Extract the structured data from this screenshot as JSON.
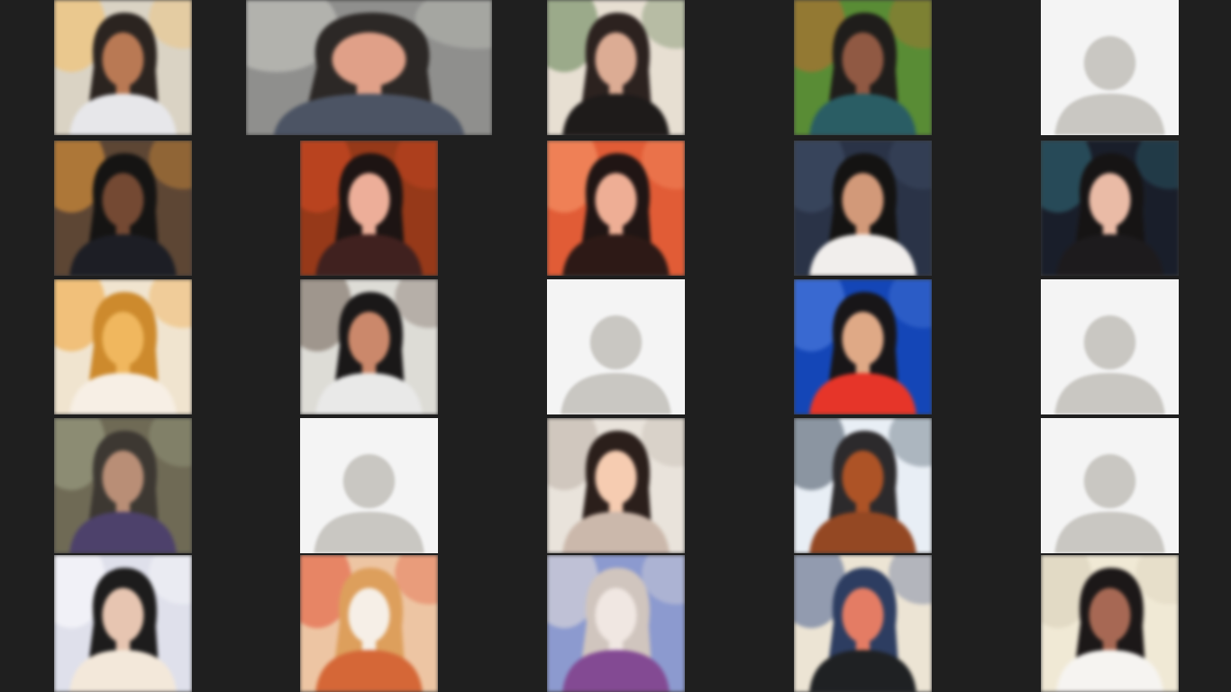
{
  "app": {
    "view": "gallery"
  },
  "colors": {
    "background": "#1f1f1f",
    "tile_placeholder": "#f4f4f4",
    "avatar_glyph": "#c9c7c2"
  },
  "columns": [
    {
      "tiles": [
        {
          "kind": "video",
          "bg": "#d9d3c6",
          "accent": "#f0c070",
          "hair": "#2a2421",
          "skin": "#b27a5a",
          "shirt": "#e7e7ea"
        },
        {
          "kind": "video",
          "bg": "#5a4637",
          "accent": "#e8a34a",
          "hair": "#151413",
          "skin": "#6f4a37",
          "shirt": "#1d1e24"
        },
        {
          "kind": "video",
          "bg": "#efe4d2",
          "accent": "#e7a444",
          "hair": "#c58b3a",
          "skin": "#e9b86a",
          "shirt": "#f6efe6"
        },
        {
          "kind": "video",
          "bg": "#6e6a58",
          "accent": "#a6a890",
          "hair": "#3c3833",
          "skin": "#b48f7a",
          "shirt": "#4c4266"
        },
        {
          "kind": "video",
          "bg": "#dfe0ea",
          "accent": "#ffffff",
          "hair": "#1d1c1c",
          "skin": "#e3c6b4",
          "shirt": "#f2e8dc"
        }
      ]
    },
    {
      "tiles": [
        {
          "kind": "video",
          "bg": "#8f8f8d",
          "accent": "#cfd0cb",
          "hair": "#2c2826",
          "skin": "#d9a28d",
          "shirt": "#4d5462"
        },
        {
          "kind": "video",
          "bg": "#8c3b1f",
          "accent": "#c8512e",
          "hair": "#1c1413",
          "skin": "#e6b09d",
          "shirt": "#3d2220"
        },
        {
          "kind": "video",
          "bg": "#dddcd7",
          "accent": "#6a5d52",
          "hair": "#1a1818",
          "skin": "#c48a70",
          "shirt": "#e9e9e8"
        },
        {
          "kind": "avatar"
        },
        {
          "kind": "video",
          "bg": "#e9c6a8",
          "accent": "#d4533a",
          "hair": "#d6a066",
          "skin": "#f5efe8",
          "shirt": "#c96a40"
        }
      ]
    },
    {
      "tiles": [
        {
          "kind": "video",
          "bg": "#e6dfd4",
          "accent": "#5e7c52",
          "hair": "#2b2220",
          "skin": "#d7ad98",
          "shirt": "#1e1b1a"
        },
        {
          "kind": "video",
          "bg": "#d35f3e",
          "accent": "#f0a178",
          "hair": "#1f1514",
          "skin": "#e7b09a",
          "shirt": "#2b1a17"
        },
        {
          "kind": "avatar"
        },
        {
          "kind": "video",
          "bg": "#e8e3dc",
          "accent": "#b9b1a8",
          "hair": "#2a1f1c",
          "skin": "#f1cdb5",
          "shirt": "#c9b8ad"
        },
        {
          "kind": "video",
          "bg": "#8e9ac8",
          "accent": "#e8e1dc",
          "hair": "#cfc5bf",
          "skin": "#efe7e3",
          "shirt": "#7e4c8c"
        }
      ]
    },
    {
      "tiles": [
        {
          "kind": "video",
          "bg": "#5d8a3e",
          "accent": "#b96c3a",
          "hair": "#1f1d1b",
          "skin": "#8a5a47",
          "shirt": "#2f5c62"
        },
        {
          "kind": "video",
          "bg": "#2b3344",
          "accent": "#46526a",
          "hair": "#141312",
          "skin": "#cc9a7e",
          "shirt": "#f1eeec"
        },
        {
          "kind": "video",
          "bg": "#1a46a8",
          "accent": "#5e86d8",
          "hair": "#181618",
          "skin": "#d9aa8c",
          "shirt": "#d43a2f"
        },
        {
          "kind": "video",
          "bg": "#e9eef4",
          "accent": "#3f4c5a",
          "hair": "#2c2a2c",
          "skin": "#a3552e",
          "shirt": "#8c4a2a"
        },
        {
          "kind": "video",
          "bg": "#ebe4d6",
          "accent": "#4a5f8a",
          "hair": "#2f3d5c",
          "skin": "#d97f6a",
          "shirt": "#1f2123"
        }
      ]
    },
    {
      "tiles": [
        {
          "kind": "avatar"
        },
        {
          "kind": "video",
          "bg": "#1a1e28",
          "accent": "#3a6d7a",
          "hair": "#161414",
          "skin": "#e5bcaa",
          "shirt": "#1d1b1d"
        },
        {
          "kind": "avatar"
        },
        {
          "kind": "avatar"
        },
        {
          "kind": "video",
          "bg": "#efe9d8",
          "accent": "#d6cdbb",
          "hair": "#1c1818",
          "skin": "#a06a58",
          "shirt": "#f6f4f1"
        }
      ]
    }
  ]
}
